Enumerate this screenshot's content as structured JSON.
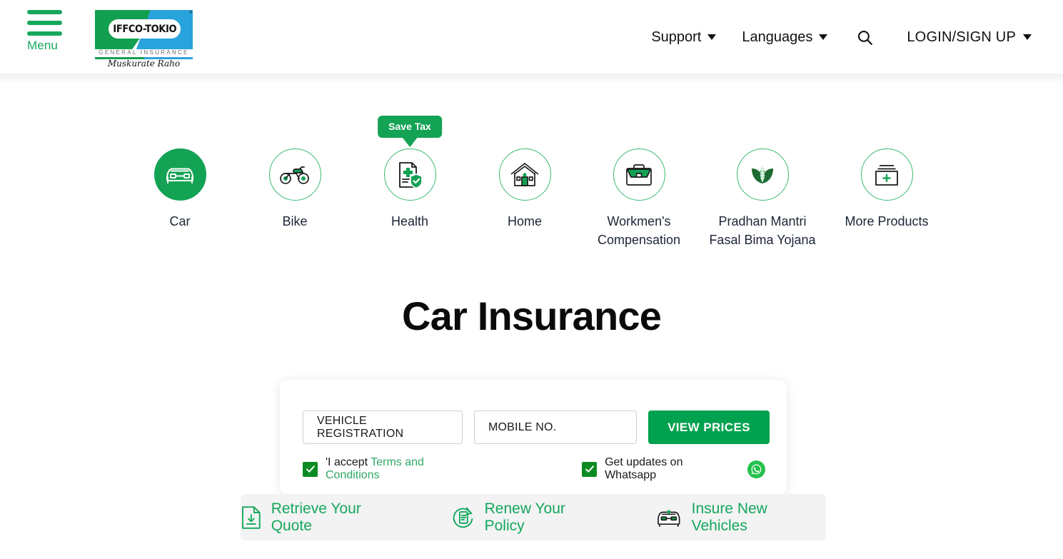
{
  "header": {
    "menu_label": "Menu",
    "logo": {
      "name": "IFFCO-TOKIO",
      "subtitle": "GENERAL INSURANCE",
      "tagline": "Muskurate Raho",
      "trademark": "®"
    },
    "nav": [
      {
        "label": "Support",
        "icon": "chevron-down-icon"
      },
      {
        "label": "Languages",
        "icon": "chevron-down-icon"
      }
    ],
    "search_icon": "search-icon",
    "login_label": "LOGIN/SIGN UP"
  },
  "products": [
    {
      "label": "Car",
      "icon": "car-icon",
      "active": true,
      "badge": null
    },
    {
      "label": "Bike",
      "icon": "bike-icon",
      "active": false,
      "badge": null
    },
    {
      "label": "Health",
      "icon": "health-document-shield-icon",
      "active": false,
      "badge": "Save Tax"
    },
    {
      "label": "Home",
      "icon": "house-icon",
      "active": false,
      "badge": null
    },
    {
      "label": "Workmen's\nCompensation",
      "icon": "briefcase-icon",
      "active": false,
      "badge": null
    },
    {
      "label": "Pradhan Mantri\nFasal Bima Yojana",
      "icon": "crop-wheat-icon",
      "active": false,
      "badge": null
    },
    {
      "label": "More Products",
      "icon": "folder-plus-icon",
      "active": false,
      "badge": null
    }
  ],
  "main": {
    "title": "Car Insurance",
    "form": {
      "vehicle_registration_value": "VEHICLE REGISTRATION",
      "vehicle_registration_placeholder": "VEHICLE REGISTRATION",
      "mobile_value": "MOBILE NO.",
      "mobile_placeholder": "MOBILE NO.",
      "submit_label": "VIEW PRICES",
      "terms_prefix": "'I accept ",
      "terms_link": "Terms and Conditions",
      "terms_checked": true,
      "whatsapp_label": "Get updates on Whatsapp",
      "whatsapp_checked": true,
      "whatsapp_icon": "whatsapp-icon"
    }
  },
  "quick_links": [
    {
      "label": "Retrieve Your Quote",
      "icon": "document-download-icon"
    },
    {
      "label": "Renew Your Policy",
      "icon": "refresh-document-icon"
    },
    {
      "label": "Insure New Vehicles",
      "icon": "car-front-icon"
    }
  ],
  "colors": {
    "brand_green": "#00a14f",
    "icon_green": "#14a254",
    "link_green": "#14a75d",
    "checkbox_green": "#0c8b22",
    "logo_blue": "#29a3dc",
    "linkbar_bg": "#f3f3f3",
    "text_dark": "#1c2536"
  }
}
